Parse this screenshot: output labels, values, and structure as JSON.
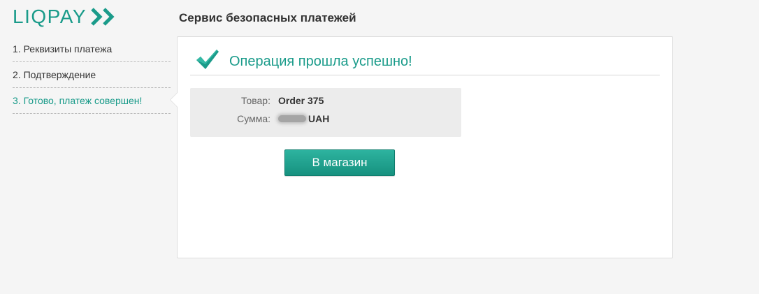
{
  "logo": {
    "text": "LIQPAY",
    "icon": "double-chevron-right-icon"
  },
  "header": {
    "title": "Сервис безопасных платежей"
  },
  "steps": [
    {
      "label": "1. Реквизиты платежа",
      "active": false
    },
    {
      "label": "2. Подтверждение",
      "active": false
    },
    {
      "label": "3. Готово, платеж совершен!",
      "active": true
    }
  ],
  "result": {
    "icon": "checkmark-icon",
    "message": "Операция прошла успешно!"
  },
  "details": {
    "product_label": "Товар:",
    "product_value": "Order 375",
    "amount_label": "Сумма:",
    "amount_currency": "UAH"
  },
  "actions": {
    "shop_button_label": "В магазин"
  },
  "colors": {
    "accent": "#1a9b8a",
    "background": "#f5f5f5",
    "panel": "#ffffff",
    "info_box": "#ececec"
  }
}
